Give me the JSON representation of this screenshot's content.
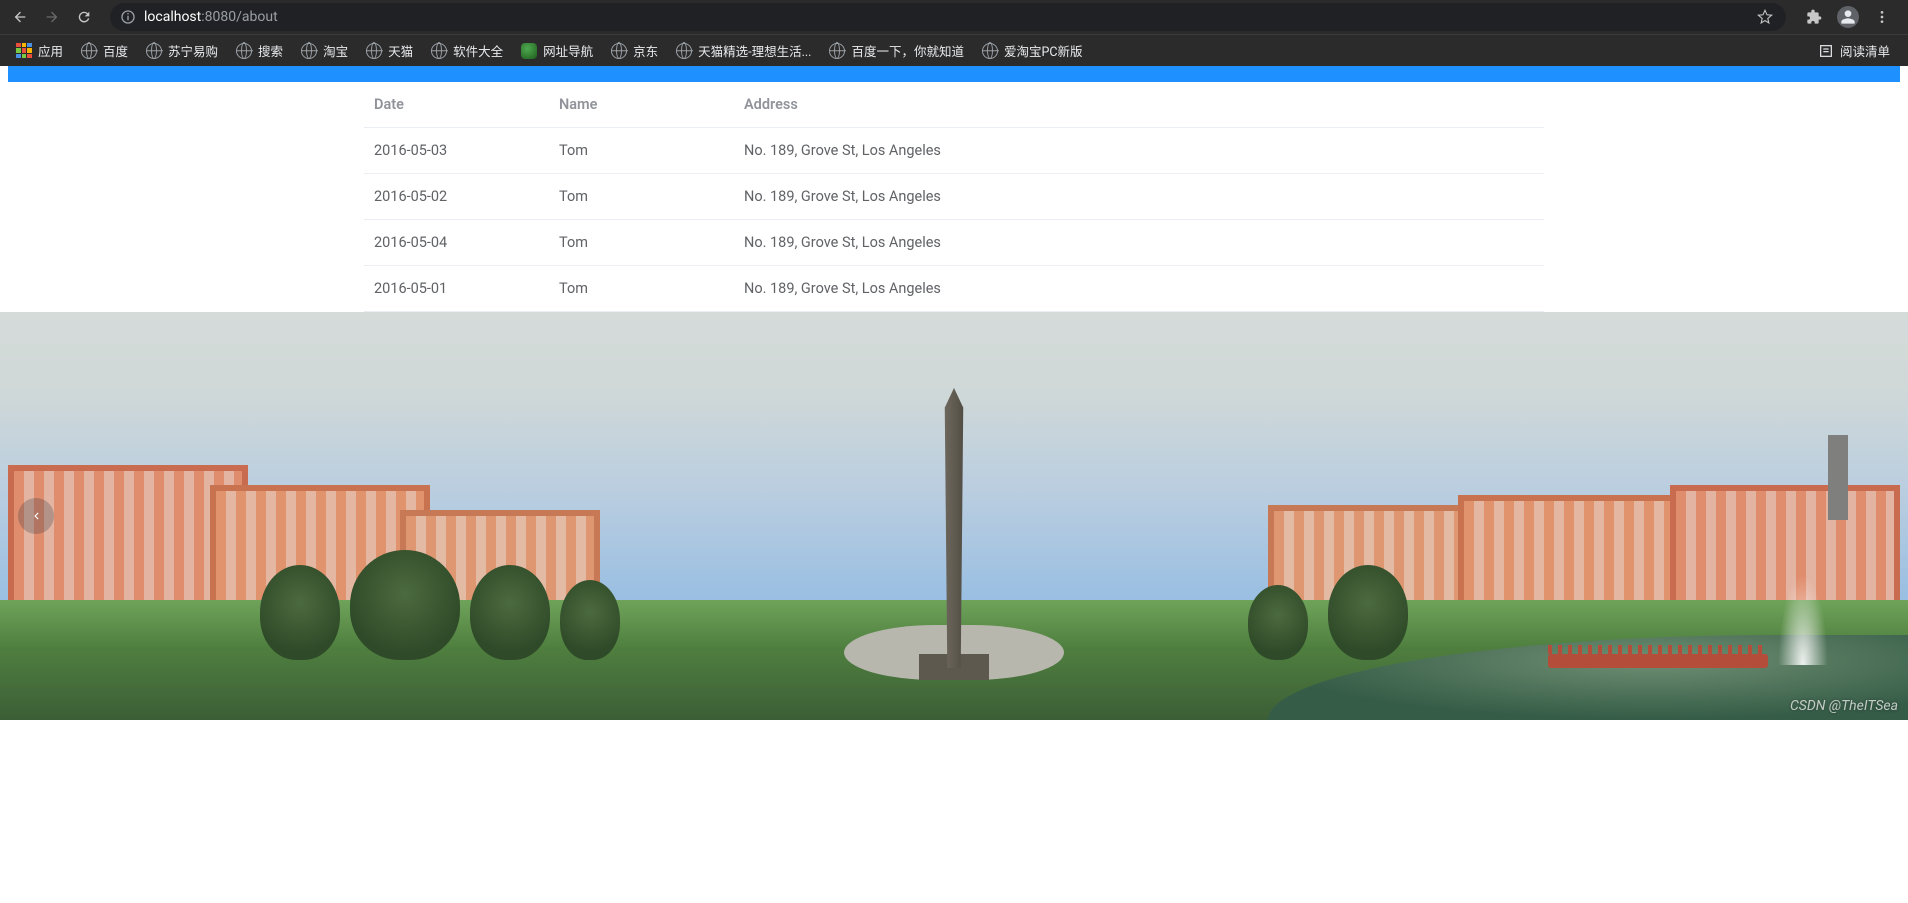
{
  "browser": {
    "url_host": "localhost",
    "url_port": ":8080",
    "url_path": "/about",
    "apps_label": "应用",
    "reading_list_label": "阅读清单",
    "bookmarks": [
      {
        "label": "百度",
        "icon": "globe"
      },
      {
        "label": "苏宁易购",
        "icon": "globe"
      },
      {
        "label": "搜索",
        "icon": "globe"
      },
      {
        "label": "淘宝",
        "icon": "globe"
      },
      {
        "label": "天猫",
        "icon": "globe"
      },
      {
        "label": "软件大全",
        "icon": "globe"
      },
      {
        "label": "网址导航",
        "icon": "green"
      },
      {
        "label": "京东",
        "icon": "globe"
      },
      {
        "label": "天猫精选-理想生活...",
        "icon": "globe"
      },
      {
        "label": "百度一下，你就知道",
        "icon": "globe"
      },
      {
        "label": "爱淘宝PC新版",
        "icon": "globe"
      }
    ]
  },
  "table": {
    "headers": {
      "date": "Date",
      "name": "Name",
      "address": "Address"
    },
    "rows": [
      {
        "date": "2016-05-03",
        "name": "Tom",
        "address": "No. 189, Grove St, Los Angeles"
      },
      {
        "date": "2016-05-02",
        "name": "Tom",
        "address": "No. 189, Grove St, Los Angeles"
      },
      {
        "date": "2016-05-04",
        "name": "Tom",
        "address": "No. 189, Grove St, Los Angeles"
      },
      {
        "date": "2016-05-01",
        "name": "Tom",
        "address": "No. 189, Grove St, Los Angeles"
      }
    ]
  },
  "hero": {
    "watermark": "CSDN @TheITSea"
  }
}
